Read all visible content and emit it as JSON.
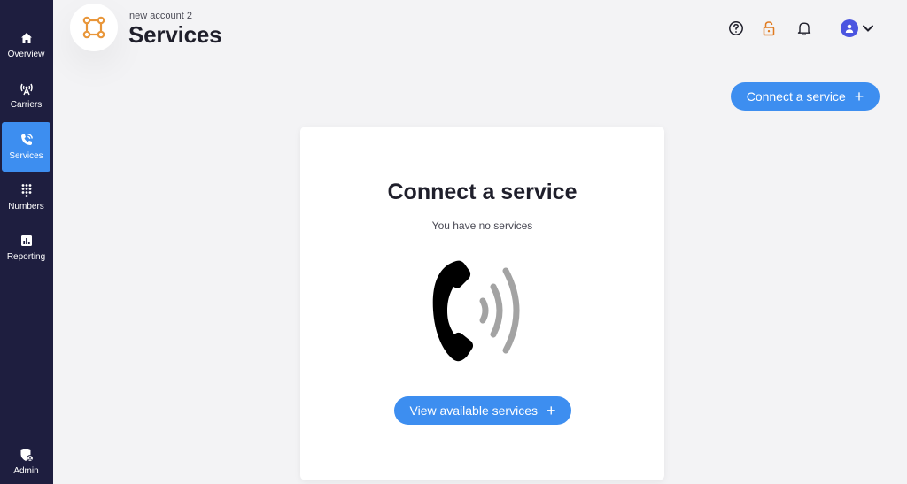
{
  "sidebar": {
    "items": [
      {
        "label": "Overview",
        "icon": "home-icon"
      },
      {
        "label": "Carriers",
        "icon": "antenna-icon"
      },
      {
        "label": "Services",
        "icon": "phone-icon",
        "active": true
      },
      {
        "label": "Numbers",
        "icon": "dialpad-icon"
      },
      {
        "label": "Reporting",
        "icon": "bar-chart-icon"
      },
      {
        "label": "Admin",
        "icon": "shield-user-icon"
      }
    ]
  },
  "header": {
    "account": "new account 2",
    "title": "Services",
    "icons": [
      "help-icon",
      "lock-icon",
      "bell-icon",
      "user-avatar-icon",
      "chevron-down-icon"
    ]
  },
  "actions": {
    "connect_label": "Connect a service"
  },
  "empty_state": {
    "title": "Connect a service",
    "subtitle": "You have no services",
    "button_label": "View available services"
  },
  "colors": {
    "sidebar_bg": "#1e1e3f",
    "accent": "#3d8ef0",
    "lock": "#e07a1f",
    "logo": "#e8963a",
    "avatar": "#4b55e0"
  }
}
